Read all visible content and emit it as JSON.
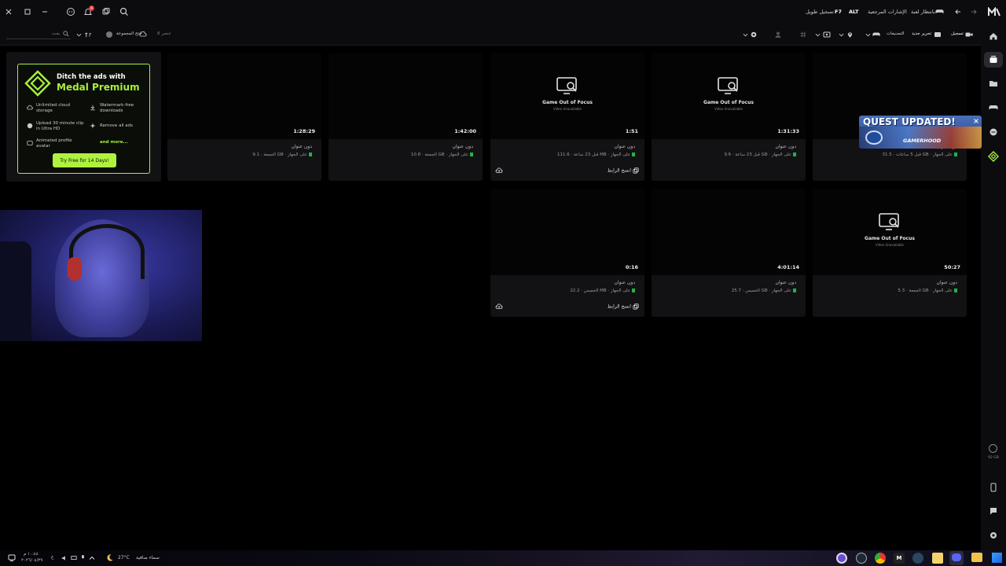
{
  "titlebar": {
    "notification_count": "4",
    "nav_items": [
      "تسجيل طويل",
      "F7",
      "ALT",
      "الإشارات المرجعية",
      "بانتظار لعبة"
    ]
  },
  "toolbar": {
    "search_placeholder": "بحث",
    "items_count": "8 عنصر",
    "sync_label": "فتح المجموعة",
    "record_label": "تسجيل",
    "new_rec_label": "تحرير جديد",
    "categories_label": "التصنيفات"
  },
  "promo": {
    "headline_1": "Ditch the ads with",
    "headline_2": "Medal Premium",
    "features": [
      "Unlimited cloud storage",
      "Watermark-free downloads",
      "Upload 30 minute clip in Ultra HD",
      "Remove all ads",
      "Animated profile avatar",
      "and more..."
    ],
    "cta": "Try Free for 14 Days!"
  },
  "cards": [
    {
      "duration": "1:28:29",
      "title": "دون عنوان",
      "meta": "الجمعة · 9.1 GB · على الجهاز",
      "oof": false,
      "actions": false
    },
    {
      "duration": "1:42:00",
      "title": "دون عنوان",
      "meta": "الجمعة · 10.8 GB · على الجهاز",
      "oof": false,
      "actions": false
    },
    {
      "duration": "1:51",
      "title": "دون عنوان",
      "meta": "قبل 23 ساعة · 111.6 MB · على الجهاز",
      "oof": true,
      "actions": true
    },
    {
      "duration": "1:31:33",
      "title": "دون عنوان",
      "meta": "قبل 23 ساعة · 9.6 GB · على الجهاز",
      "oof": true,
      "actions": false
    },
    {
      "duration": "",
      "title": "دون عنوان",
      "meta": "قبل 5 ساعات · 31.5 GB · على الجهاز",
      "oof": false,
      "actions": false
    },
    {
      "duration": "0:16",
      "title": "دون عنوان",
      "meta": "الخميس · 22.2 MB · على الجهاز",
      "oof": false,
      "actions": true
    },
    {
      "duration": "4:01:14",
      "title": "دون عنوان",
      "meta": "الخميس · 25.7 GB · على الجهاز",
      "oof": false,
      "actions": false
    },
    {
      "duration": "50:27",
      "title": "دون عنوان",
      "meta": "الجمعة · 5.3 GB · على الجهاز",
      "oof": true,
      "actions": false
    }
  ],
  "oof_title": "Game Out of Focus",
  "oof_sub": "Video Unavailable",
  "copy_link": "انسخ الرابط",
  "quest": {
    "title": "QUEST UPDATED!",
    "brand": "GAMERHOOD"
  },
  "storage": {
    "value": "92 GB"
  },
  "taskbar": {
    "weather_temp": "27°C",
    "weather_text": "سماء صافية",
    "time": "١٠:٤٤ م",
    "date": "٢٠٢٦/٠٤/٢٩"
  }
}
